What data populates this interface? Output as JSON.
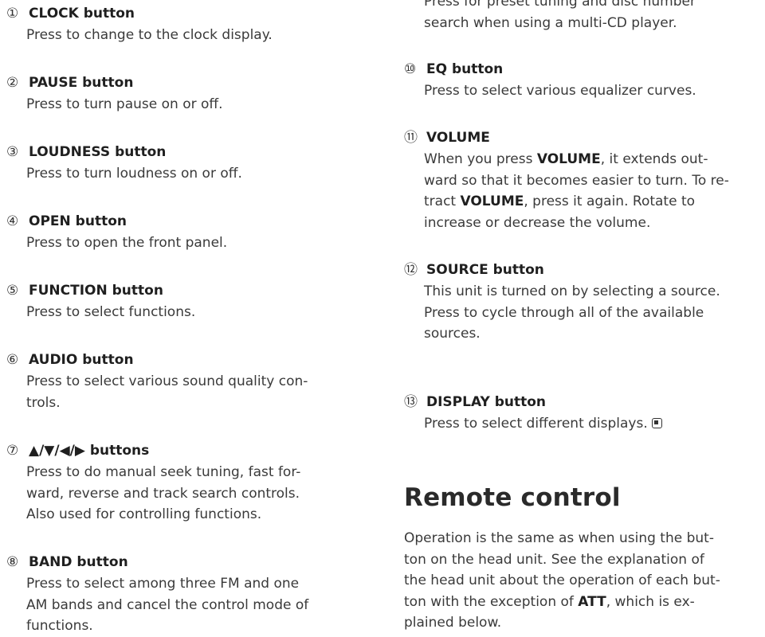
{
  "left_entries": [
    {
      "num": "①",
      "title": "CLOCK button",
      "lines": [
        "Press to change to the clock display."
      ]
    },
    {
      "num": "②",
      "title": "PAUSE button",
      "lines": [
        "Press to turn pause on or off."
      ]
    },
    {
      "num": "③",
      "title": "LOUDNESS button",
      "lines": [
        "Press to turn loudness on or off."
      ]
    },
    {
      "num": "④",
      "title": "OPEN button",
      "lines": [
        "Press to open the front panel."
      ]
    },
    {
      "num": "⑤",
      "title": "FUNCTION button",
      "lines": [
        "Press to select functions."
      ]
    },
    {
      "num": "⑥",
      "title": "AUDIO button",
      "lines": [
        "Press to select various sound quality con-",
        "trols."
      ]
    },
    {
      "num": "⑦",
      "title": "▲/▼/◀/▶ buttons",
      "lines": [
        "Press to do manual seek tuning, fast for-",
        "ward, reverse and track search controls.",
        "Also used for controlling functions."
      ]
    },
    {
      "num": "⑧",
      "title": "BAND button",
      "lines": [
        "Press to select among three FM and one",
        "AM bands and cancel the control mode of",
        "functions."
      ]
    }
  ],
  "right_top_cut": [
    "Press for preset tuning and disc number",
    "search when using a multi-CD player."
  ],
  "right_entries": [
    {
      "num": "⑩",
      "title": "EQ button",
      "lines": [
        "Press to select various equalizer curves."
      ]
    },
    {
      "num": "⑪",
      "title": "VOLUME",
      "lines": [
        "When you press ##VOLUME##, it extends out-",
        "ward so that it becomes easier to turn. To re-",
        "tract ##VOLUME##, press it again. Rotate to",
        "increase or decrease the volume."
      ]
    },
    {
      "num": "⑫",
      "title": "SOURCE button",
      "lines": [
        "This unit is turned on by selecting a source.",
        "Press to cycle through all of the available",
        "sources."
      ]
    },
    {
      "num": "⑬",
      "title": "DISPLAY button",
      "lines": [
        "Press to select different displays."
      ],
      "end_mark": true
    }
  ],
  "section": {
    "title": "Remote control",
    "lines": [
      "Operation is the same as when using the but-",
      "ton on the head unit. See the explanation of",
      "the head unit about the operation of each but-",
      "ton with the exception of ##ATT##, which is ex-",
      "plained below."
    ]
  }
}
